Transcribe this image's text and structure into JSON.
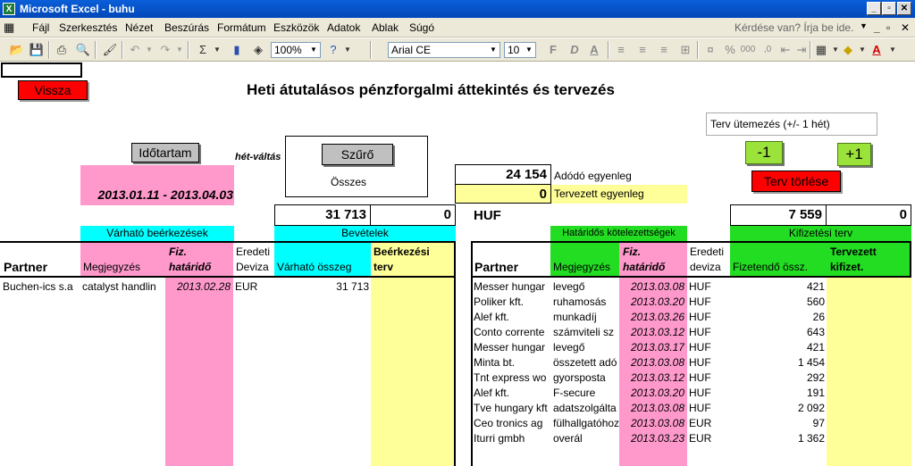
{
  "window": {
    "title": "Microsoft Excel - buhu"
  },
  "menu": {
    "items": [
      "Fájl",
      "Szerkesztés",
      "Nézet",
      "Beszúrás",
      "Formátum",
      "Eszközök",
      "Adatok",
      "Ablak",
      "Súgó"
    ],
    "help_placeholder": "Kérdése van? Írja be ide."
  },
  "toolbar": {
    "zoom": "100%",
    "font": "Arial CE",
    "font_size": "10",
    "bold": "F",
    "italic": "D",
    "underline": "A",
    "sigma": "Σ",
    "percent": "%",
    "font_color_letter": "A"
  },
  "sheet": {
    "title": "Heti átutalásos pénzforgalmi áttekintés és tervezés",
    "buttons": {
      "vissza": "Vissza",
      "idotartam": "Időtartam",
      "szuro": "Szűrő",
      "minus": "-1",
      "plus": "+1",
      "terv_torlese": "Terv törlése"
    },
    "het_valtas": "hét-váltás",
    "osszes": "Összes",
    "date_range": "2013.01.11 - 2013.04.03",
    "terv_utemezes": "Terv ütemezés (+/- 1 hét)",
    "adodo_value": "24 154",
    "adodo_label": "Adódó egyenleg",
    "tervezett_value": "0",
    "tervezett_label": "Tervezett egyenleg",
    "currency": "HUF",
    "left_total": "31 713",
    "left_total2": "0",
    "right_total": "7 559",
    "right_total2": "0",
    "sections": {
      "varhato_beerkezesek": "Várható beérkezések",
      "bevetelek": "Bevételek",
      "hataridos": "Határidős kötelezettségek",
      "kifizetesi_terv": "Kifizetési terv"
    },
    "left_headers": {
      "partner": "Partner",
      "megjegyzes": "Megjegyzés",
      "fiz_hatarido_1": "Fiz.",
      "fiz_hatarido_2": "határidő",
      "eredeti_1": "Eredeti",
      "eredeti_2": "Deviza",
      "varhato_osszeg": "Várható összeg",
      "beerkezesi_1": "Beérkezési",
      "beerkezesi_2": "terv"
    },
    "right_headers": {
      "partner": "Partner",
      "megjegyzes": "Megjegyzés",
      "fiz_hatarido_1": "Fiz.",
      "fiz_hatarido_2": "határidő",
      "eredeti_1": "Eredeti",
      "eredeti_2": "deviza",
      "fizetendo": "Fizetendő össz.",
      "tervezett_1": "Tervezett",
      "tervezett_2": "kifizet."
    },
    "left_rows": [
      {
        "partner": "Buchen-ics s.a",
        "note": "catalyst handlin",
        "date": "2013.02.28",
        "cur": "EUR",
        "amount": "31 713"
      }
    ],
    "right_rows": [
      {
        "partner": "Messer hungar",
        "note": "levegő",
        "date": "2013.03.08",
        "cur": "HUF",
        "amount": "421"
      },
      {
        "partner": "Poliker kft.",
        "note": "ruhamosás",
        "date": "2013.03.20",
        "cur": "HUF",
        "amount": "560"
      },
      {
        "partner": "Alef kft.",
        "note": "munkadíj",
        "date": "2013.03.26",
        "cur": "HUF",
        "amount": "26"
      },
      {
        "partner": "Conto corrente",
        "note": "számviteli sz",
        "date": "2013.03.12",
        "cur": "HUF",
        "amount": "643"
      },
      {
        "partner": "Messer hungar",
        "note": "levegő",
        "date": "2013.03.17",
        "cur": "HUF",
        "amount": "421"
      },
      {
        "partner": "Minta bt.",
        "note": "összetett adó",
        "date": "2013.03.08",
        "cur": "HUF",
        "amount": "1 454"
      },
      {
        "partner": "Tnt express wo",
        "note": "gyorsposta",
        "date": "2013.03.12",
        "cur": "HUF",
        "amount": "292"
      },
      {
        "partner": "Alef kft.",
        "note": "F-secure",
        "date": "2013.03.20",
        "cur": "HUF",
        "amount": "191"
      },
      {
        "partner": "Tve hungary kft",
        "note": "adatszolgálta",
        "date": "2013.03.08",
        "cur": "HUF",
        "amount": "2 092"
      },
      {
        "partner": "Ceo tronics ag",
        "note": "fülhallgatóhoz",
        "date": "2013.03.08",
        "cur": "EUR",
        "amount": "97"
      },
      {
        "partner": "Iturri gmbh",
        "note": "overál",
        "date": "2013.03.23",
        "cur": "EUR",
        "amount": "1 362"
      }
    ]
  }
}
